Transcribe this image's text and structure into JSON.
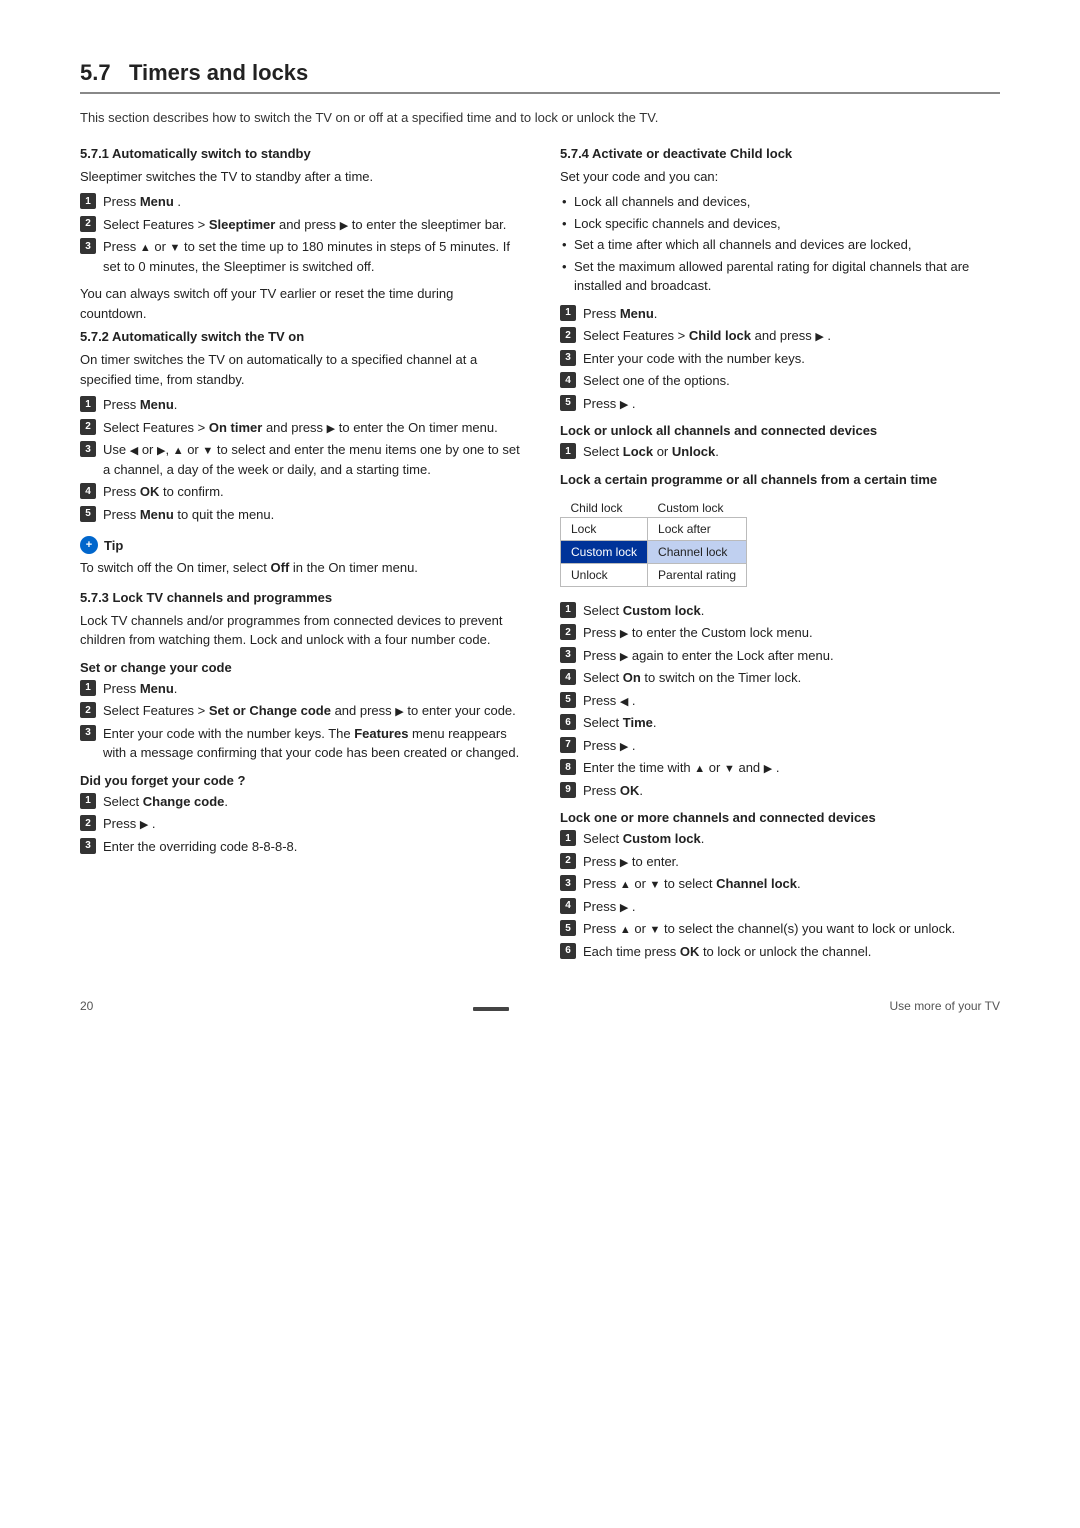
{
  "page": {
    "section": "5.7",
    "title": "Timers and locks",
    "intro": "This section describes how to switch the TV on or off at a specified time and to lock or unlock the TV.",
    "page_number": "20",
    "footer_right": "Use more of your TV"
  },
  "subsections": {
    "s571": {
      "title": "5.7.1   Automatically switch to standby",
      "intro": "Sleeptimer switches the TV to standby after a time.",
      "steps": [
        "Press Menu .",
        "Select Features > Sleeptimer and press ▶ to enter the sleeptimer bar.",
        "Press ▲ or ▼ to set the time up to 180 minutes in steps of 5 minutes. If set to 0 minutes, the Sleeptimer is switched off."
      ],
      "note1": "You can always switch off your TV earlier or reset the time during countdown."
    },
    "s572": {
      "title": "5.7.2   Automatically switch the TV on",
      "intro": "On timer switches the TV on automatically to a specified channel at a specified time, from standby.",
      "steps": [
        "Press Menu.",
        "Select Features > On timer and press ▶ to enter the On timer menu.",
        "Use ◀ or ▶, ▲ or ▼ to select and enter the menu items one by one to set a channel, a day of the week or daily, and a starting time.",
        "Press OK to confirm.",
        "Press Menu to quit the menu."
      ],
      "tip_title": "Tip",
      "tip_text": "To switch off the On timer, select Off in the On timer menu."
    },
    "s573": {
      "title": "5.7.3   Lock TV channels and programmes",
      "intro": "Lock TV channels and/or programmes from connected devices to prevent children from watching them. Lock and unlock with a four number code.",
      "set_code_heading": "Set or change your code",
      "set_code_steps": [
        "Press Menu.",
        "Select Features > Set or Change code and press ▶ to enter your code.",
        "Enter your code with the number keys. The Features menu reappears with a message confirming that your code has been created or changed."
      ],
      "forgot_heading": "Did you forget your code ?",
      "forgot_steps": [
        "Select Change code.",
        "Press ▶ .",
        "Enter the overriding code 8-8-8-8."
      ]
    },
    "s574": {
      "title": "5.7.4   Activate or deactivate Child lock",
      "intro": "Set your code and you can:",
      "bullets": [
        "Lock all channels and devices,",
        "Lock specific channels and devices,",
        "Set a time after which all channels and devices are locked,",
        "Set the maximum allowed parental rating for digital channels that are installed and broadcast."
      ],
      "steps": [
        "Press Menu.",
        "Select Features > Child lock and press ▶ .",
        "Enter your code with the number keys.",
        "Select one of the options.",
        "Press ▶ ."
      ],
      "lock_unlock_heading": "Lock or unlock all channels and connected devices",
      "lock_unlock_step": "Select Lock or Unlock.",
      "timer_lock_heading": "Lock a certain programme or all channels from a certain time",
      "table": {
        "header": [
          "Child lock",
          "Custom lock"
        ],
        "rows": [
          [
            "Lock",
            "Lock after"
          ],
          [
            "Custom lock",
            "Channel lock"
          ],
          [
            "Unlock",
            "Parental rating"
          ]
        ],
        "selected_left": "Custom lock",
        "selected_right": "Channel lock"
      },
      "timer_steps": [
        "Select Custom lock.",
        "Press ▶ to enter the Custom lock menu.",
        "Press ▶ again to enter the Lock after menu.",
        "Select On to switch on the Timer lock.",
        "Press ◀ .",
        "Select Time.",
        "Press ▶ .",
        "Enter the time with ▲ or ▼ and ▶ .",
        "Press OK."
      ],
      "channel_lock_heading": "Lock one or more channels and connected devices",
      "channel_lock_steps": [
        "Select Custom lock.",
        "Press ▶ to enter.",
        "Press ▲ or ▼ to select Channel lock.",
        "Press ▶ .",
        "Press ▲ or ▼ to select the channel(s) you want to lock or unlock.",
        "Each time press OK to lock or unlock the channel."
      ]
    }
  }
}
